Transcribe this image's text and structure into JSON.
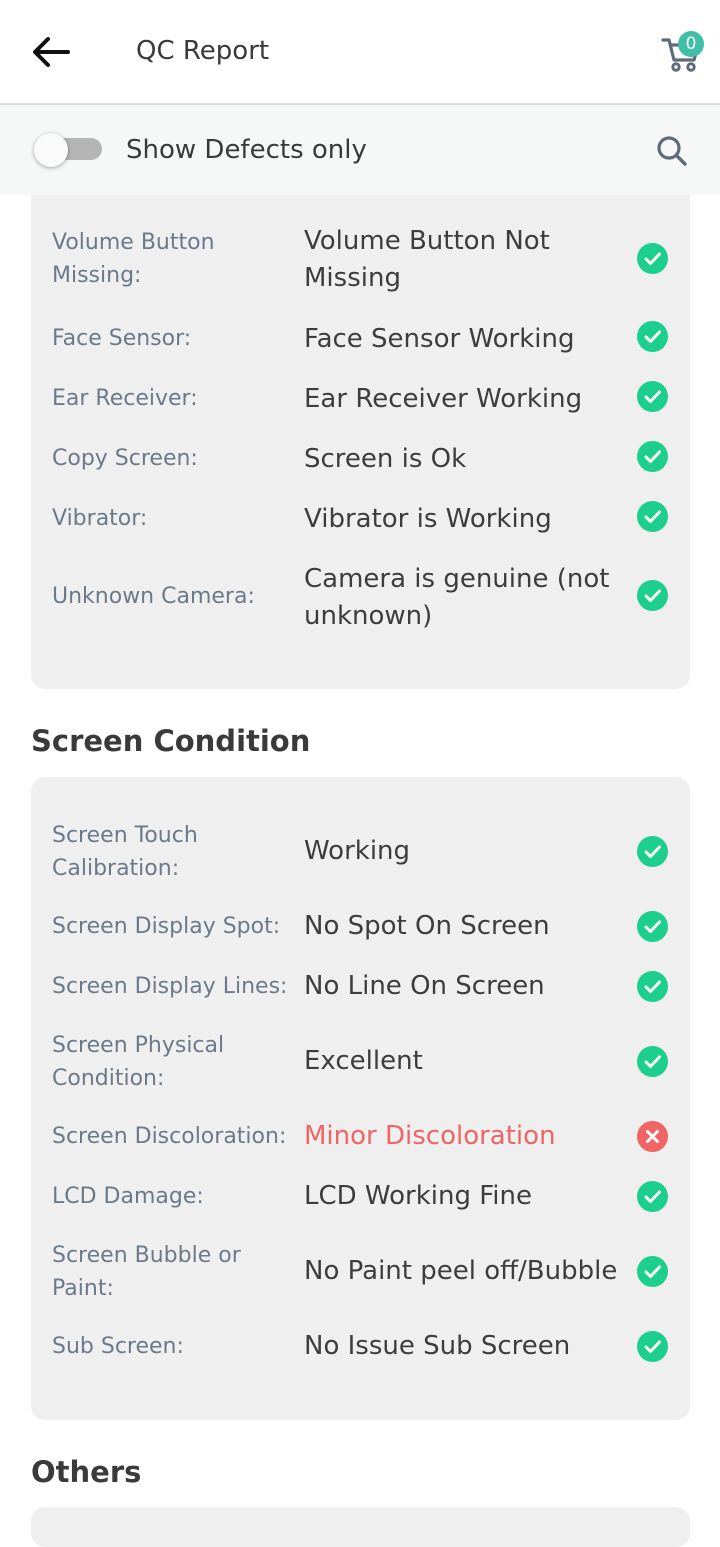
{
  "header": {
    "title": "QC Report",
    "cart_count": "0"
  },
  "filter": {
    "label": "Show Defects only",
    "toggle_on": false
  },
  "colors": {
    "pass": "#1dcf8c",
    "fail": "#ef6464",
    "accent": "#3fbfa6"
  },
  "sections": [
    {
      "title": "",
      "rows": [
        {
          "label": "Volume Button Missing:",
          "value": "Volume Button Not Missing",
          "status": "pass"
        },
        {
          "label": "Face Sensor:",
          "value": "Face Sensor Working",
          "status": "pass"
        },
        {
          "label": "Ear Receiver:",
          "value": "Ear Receiver Working",
          "status": "pass"
        },
        {
          "label": "Copy Screen:",
          "value": "Screen is Ok",
          "status": "pass"
        },
        {
          "label": "Vibrator:",
          "value": "Vibrator is Working",
          "status": "pass"
        },
        {
          "label": "Unknown Camera:",
          "value": "Camera is genuine (not unknown)",
          "status": "pass"
        }
      ]
    },
    {
      "title": "Screen Condition",
      "rows": [
        {
          "label": "Screen Touch Calibration:",
          "value": "Working",
          "status": "pass"
        },
        {
          "label": "Screen Display Spot:",
          "value": "No Spot On Screen",
          "status": "pass"
        },
        {
          "label": "Screen Display Lines:",
          "value": "No Line On Screen",
          "status": "pass"
        },
        {
          "label": "Screen Physical Condition:",
          "value": "Excellent",
          "status": "pass"
        },
        {
          "label": "Screen Discoloration:",
          "value": "Minor Discoloration",
          "status": "fail"
        },
        {
          "label": "LCD Damage:",
          "value": "LCD Working Fine",
          "status": "pass"
        },
        {
          "label": "Screen Bubble or Paint:",
          "value": "No Paint peel off/Bubble",
          "status": "pass"
        },
        {
          "label": "Sub Screen:",
          "value": "No Issue Sub Screen",
          "status": "pass"
        }
      ]
    },
    {
      "title": "Others",
      "rows": []
    }
  ]
}
